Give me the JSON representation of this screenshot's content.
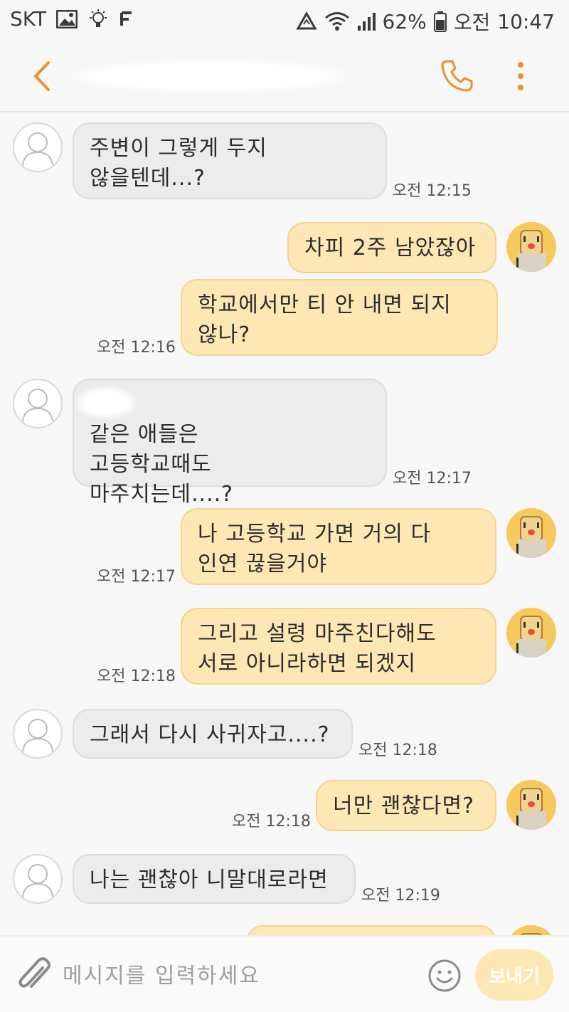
{
  "status_bar": {
    "carrier": "SKT",
    "battery": "62%",
    "ampm": "오전",
    "time": "10:47"
  },
  "header": {
    "back_icon": "chevron-left-icon",
    "call_icon": "phone-icon",
    "more_icon": "more-vert-icon",
    "accent": "#e8912c"
  },
  "messages": [
    {
      "dir": "in",
      "text": "주변이 그렇게 두지\n않을텐데...?",
      "time": "오전 12:15"
    },
    {
      "dir": "out",
      "text": "차피 2주 남았잖아",
      "time": ""
    },
    {
      "dir": "out",
      "text": "학교에서만 티 안 내면 되지\n않나?",
      "time": "오전 12:16"
    },
    {
      "dir": "in",
      "text": "같은 애들은\n고등학교때도\n마주치는데....?",
      "time": "오전 12:17"
    },
    {
      "dir": "out",
      "text": "나 고등학교 가면 거의 다\n인연 끊을거야",
      "time": "오전 12:17"
    },
    {
      "dir": "out",
      "text": "그리고 설령 마주친다해도\n서로 아니라하면 되겠지",
      "time": "오전 12:18"
    },
    {
      "dir": "in",
      "text": "그래서 다시 사귀자고....?",
      "time": "오전 12:18"
    },
    {
      "dir": "out",
      "text": "너만 괜찮다면?",
      "time": "오전 12:18"
    },
    {
      "dir": "in",
      "text": "나는 괜찮아 니말대로라면",
      "time": "오전 12:19"
    }
  ],
  "input": {
    "placeholder": "메시지를 입력하세요",
    "send_label": "보내기"
  },
  "colors": {
    "incoming_bubble": "#ececec",
    "outgoing_bubble": "#fde8b5",
    "accent": "#e8912c"
  }
}
